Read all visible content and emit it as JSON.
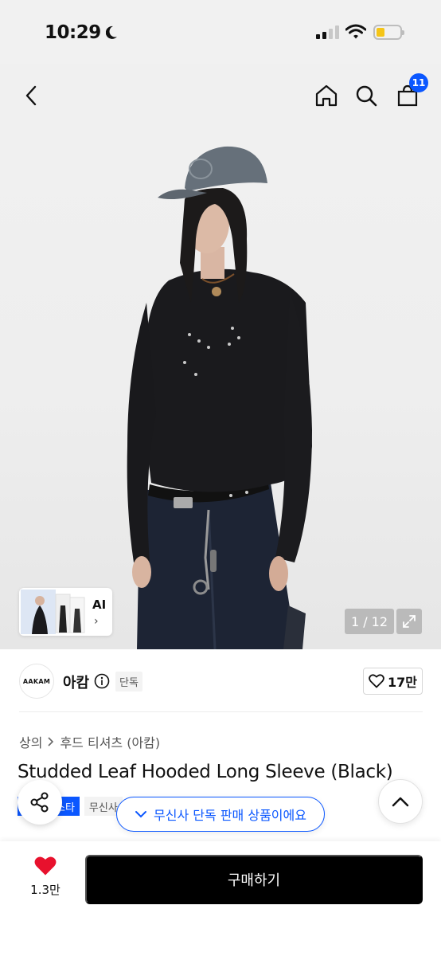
{
  "status_bar": {
    "time": "10:29",
    "battery_color": "#f5c518"
  },
  "header": {
    "cart_count": "11"
  },
  "gallery": {
    "ai_label": "AI",
    "ai_arrow": "›",
    "counter": "1 / 12"
  },
  "brand": {
    "logo_text": "AAKAM",
    "name": "아캄",
    "exclusive_tag": "단독",
    "likes": "17만"
  },
  "breadcrumb": [
    "상의",
    "후드 티셔츠 (아캄)"
  ],
  "product": {
    "title": "Studded Leaf Hooded Long Sleeve (Black)"
  },
  "tags": {
    "blue": "스타",
    "grey": "무신사"
  },
  "toast": {
    "text": "무신사 단독 판매 상품이에요"
  },
  "bottom_bar": {
    "wishlist_count": "1.3만",
    "buy_label": "구매하기"
  },
  "colors": {
    "accent": "#0b57ff",
    "wishlist_heart": "#e8112d",
    "buy_button": "#000000"
  }
}
